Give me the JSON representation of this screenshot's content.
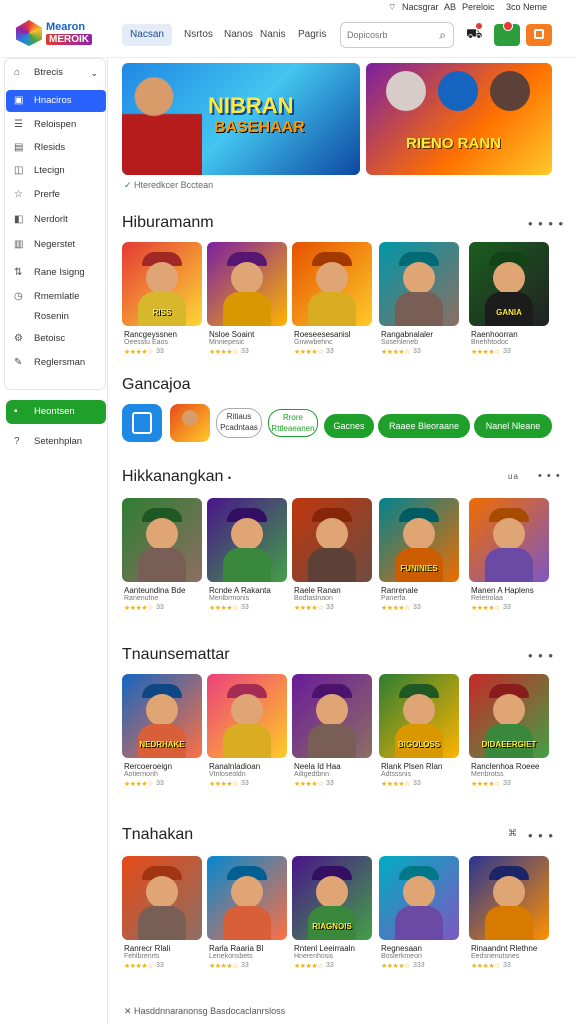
{
  "status": {
    "left": "Nacsgrar",
    "mid": "Pereloic",
    "right": "3co Neme",
    "time": "AB"
  },
  "logo": {
    "line1": "Mearon",
    "line2": "MEROIK"
  },
  "nav": {
    "tabs": [
      "Nacsan",
      "Nsrtos",
      "Nanos",
      "Nanis",
      "Pagris"
    ]
  },
  "search": {
    "placeholder": "Dopicosrb"
  },
  "sidebar": {
    "items": [
      {
        "icon": "home-icon",
        "label": "Btrecis"
      },
      {
        "icon": "grid-icon",
        "label": "Hnaciros"
      },
      {
        "icon": "list-icon",
        "label": "Reloispen"
      },
      {
        "icon": "doc-icon",
        "label": "Rlesids"
      },
      {
        "icon": "chat-icon",
        "label": "Ltecign"
      },
      {
        "icon": "star-icon",
        "label": "Prerfe"
      },
      {
        "icon": "tag-icon",
        "label": "Nerdorlt"
      },
      {
        "icon": "note-icon",
        "label": "Negerstet"
      },
      {
        "icon": "sort-icon",
        "label": "Rane Isigng"
      },
      {
        "icon": "clock-icon",
        "label": "Rmemlatle"
      },
      {
        "icon": "",
        "label": "Rosenin"
      },
      {
        "icon": "gear-icon",
        "label": "Betoisc"
      },
      {
        "icon": "edit-icon",
        "label": "Reglersman"
      }
    ],
    "cta": "Heontsen",
    "bottom": "Setenhplan"
  },
  "banners": [
    {
      "line1": "NIBRAN",
      "line2": "BASEHAAR"
    },
    {
      "line1": "RIENO RANN",
      "line2": "RIENO RANN"
    }
  ],
  "verified": "Hteredkcer Bcctean",
  "sections": [
    {
      "title": "Hiburamanm",
      "more": "• • • •",
      "cards": [
        {
          "name": "Rancgeyssnen",
          "sub": "Oeesstu Eaos",
          "stars": "★★★★☆",
          "num": "33",
          "cap": "RISS",
          "theme": [
            "#e53935",
            "#fdd835"
          ]
        },
        {
          "name": "Nsloe Soaint",
          "sub": "Mnniepesic",
          "stars": "★★★★☆",
          "num": "33",
          "cap": "",
          "theme": [
            "#7b1fa2",
            "#ffb300"
          ]
        },
        {
          "name": "Roeseesesanisl",
          "sub": "Gnwwbehnc",
          "stars": "★★★★☆",
          "num": "33",
          "cap": "",
          "theme": [
            "#e65100",
            "#ffca28"
          ]
        },
        {
          "name": "Rangabnalaler",
          "sub": "Sosenleneb",
          "stars": "★★★★☆",
          "num": "33",
          "cap": "",
          "theme": [
            "#0097a7",
            "#8d6e63"
          ]
        },
        {
          "name": "Raenhoorran",
          "sub": "Bnehhtodoc",
          "stars": "★★★★☆",
          "num": "33",
          "cap": "GANIA",
          "theme": [
            "#1b5e20",
            "#212121"
          ]
        }
      ]
    },
    {
      "title": "Hikkanangkan",
      "more": "ua",
      "cards": [
        {
          "name": "Aanteundina Bde",
          "sub": "Ranenutne",
          "stars": "★★★★☆",
          "num": "33",
          "cap": "",
          "theme": [
            "#2e7d32",
            "#8d6e63"
          ]
        },
        {
          "name": "Rcnde A Rakanta",
          "sub": "Menlbrmonis",
          "stars": "★★★★☆",
          "num": "33",
          "cap": "",
          "theme": [
            "#4a148c",
            "#43a047"
          ]
        },
        {
          "name": "Raele Ranan",
          "sub": "Bodtaslnaon",
          "stars": "★★★★☆",
          "num": "33",
          "cap": "",
          "theme": [
            "#bf360c",
            "#6d4c41"
          ]
        },
        {
          "name": "Ranrenale",
          "sub": "Panerfa",
          "stars": "★★★★☆",
          "num": "33",
          "cap": "FUNINIES",
          "theme": [
            "#00838f",
            "#ef6c00"
          ]
        },
        {
          "name": "Manen A Haplens",
          "sub": "Reletrolaa",
          "stars": "★★★★☆",
          "num": "33",
          "cap": "",
          "theme": [
            "#ef6c00",
            "#7e57c2"
          ]
        }
      ]
    },
    {
      "title": "Tnaunsemattar",
      "more": "• • •",
      "cards": [
        {
          "name": "Rercoeroeign",
          "sub": "Aotiernonh",
          "stars": "★★★★☆",
          "num": "33",
          "cap": "NEDRHAKE",
          "theme": [
            "#1565c0",
            "#ff7043"
          ]
        },
        {
          "name": "Ranalnladioan",
          "sub": "Vtnloseoldn",
          "stars": "★★★★☆",
          "num": "33",
          "cap": "",
          "theme": [
            "#ec407a",
            "#ffca28"
          ]
        },
        {
          "name": "Neela Id Haa",
          "sub": "Ailtgedtbnn",
          "stars": "★★★★☆",
          "num": "33",
          "cap": "",
          "theme": [
            "#6a1b9a",
            "#8d6e63"
          ]
        },
        {
          "name": "Rlank Plsen Rlan",
          "sub": "Adtsssnis",
          "stars": "★★★★☆",
          "num": "33",
          "cap": "BIGOLOSS",
          "theme": [
            "#2e7d32",
            "#ffb300"
          ]
        },
        {
          "name": "Ranclenhoa Roeee",
          "sub": "Menbrotss",
          "stars": "★★★★☆",
          "num": "33",
          "cap": "DIDAEERGIET",
          "theme": [
            "#c62828",
            "#43a047"
          ]
        }
      ]
    },
    {
      "title": "Tnahakan",
      "more": "• • •",
      "cards": [
        {
          "name": "Ranrecr Rlali",
          "sub": "Fehlbrenrts",
          "stars": "★★★★☆",
          "num": "33",
          "cap": "",
          "theme": [
            "#e64a19",
            "#8d6e63"
          ]
        },
        {
          "name": "Rarla Raaria Bl",
          "sub": "Lenekonsbets",
          "stars": "★★★★☆",
          "num": "33",
          "cap": "",
          "theme": [
            "#0288d1",
            "#ff7043"
          ]
        },
        {
          "name": "Rntenl Leeirraaln",
          "sub": "Hnerenhosis",
          "stars": "★★★★☆",
          "num": "33",
          "cap": "RIAGNOIS",
          "theme": [
            "#4a148c",
            "#43a047"
          ]
        },
        {
          "name": "Regnesaan",
          "sub": "Boslerkmeon",
          "stars": "★★★★☆",
          "num": "333",
          "cap": "",
          "theme": [
            "#00acc1",
            "#7e57c2"
          ]
        },
        {
          "name": "Rinaandnt Rlethne",
          "sub": "Eedsnenutsnes",
          "stars": "★★★★☆",
          "num": "33",
          "cap": "",
          "theme": [
            "#283593",
            "#ff8f00"
          ]
        }
      ]
    }
  ],
  "chips": {
    "title": "Gancajoa",
    "items": [
      {
        "label": "Ritiaus Pcadntaas",
        "style": "gray"
      },
      {
        "label": "Rrore Rttleaeanen",
        "style": "o"
      },
      {
        "label": "Gacnes",
        "style": "g"
      },
      {
        "label": "Raaee Bleoraane",
        "style": "g"
      },
      {
        "label": "Nanel Nleane",
        "style": "g"
      }
    ]
  },
  "footer": {
    "text": "Hasddnnaranonsg Basdocaclanrsloss"
  },
  "colors": {
    "primary": "#2962ff",
    "green": "#1fa02b",
    "star": "#f4b400",
    "orange": "#f57c20"
  }
}
